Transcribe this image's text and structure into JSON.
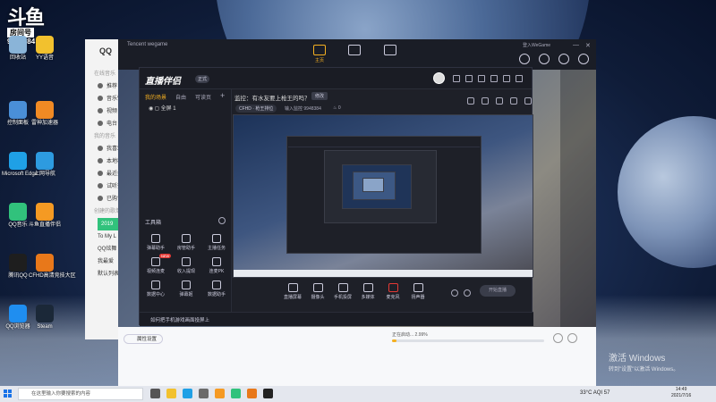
{
  "overlay": {
    "brand": "斗鱼",
    "room_label": "房间号",
    "room_number": "9948384"
  },
  "desktop_icons": [
    {
      "label": "回收站",
      "color": "#8ab4d8"
    },
    {
      "label": "YY语音",
      "color": "#f2c12e"
    },
    {
      "label": "控制面板",
      "color": "#4a8fd8"
    },
    {
      "label": "雷神加速器",
      "color": "#f08a24"
    },
    {
      "label": "Microsoft Edge",
      "color": "#1fa0e6"
    },
    {
      "label": "上网导航",
      "color": "#2d9be0"
    },
    {
      "label": "QQ音乐",
      "color": "#31c27c"
    },
    {
      "label": "斗鱼直播伴侣",
      "color": "#f59a23"
    },
    {
      "label": "腾讯QQ",
      "color": "#1e1e1e"
    },
    {
      "label": "CFHD高清竞技大区",
      "color": "#e8781a"
    },
    {
      "label": "QQ浏览器",
      "color": "#1f8ef0"
    },
    {
      "label": "Steam",
      "color": "#1b2838"
    }
  ],
  "qq_window": {
    "title": "QQ",
    "section1": "在线音乐",
    "items1": [
      "推荐",
      "音乐馆",
      "视频",
      "电台"
    ],
    "section2": "我的音乐",
    "items2": [
      "我喜欢",
      "本地和下载",
      "最近播放",
      "试听列表",
      "已购音乐"
    ],
    "section3": "创建的歌单",
    "year": "2019",
    "misc": [
      "To My L",
      "QQ炫舞",
      "我最爱",
      "默认列表"
    ]
  },
  "tencent_games": {
    "title": "Tencent wegame",
    "nav": {
      "home_label": "主页"
    },
    "wegame_label": "登入WeGame",
    "bottom": {
      "attribute_button": "属性设置",
      "status": "正在启动... 2.99%",
      "progress_percent": 2.99
    }
  },
  "streaming_app": {
    "logo": "直播伴侣",
    "version": "正式",
    "tabs": [
      "我的场景",
      "自由",
      "可读页"
    ],
    "scene": "全屏 1",
    "headline": "监控：有水友要上枪王的吗？",
    "edit_label": "修改",
    "category": "CFHD · 枪王排位",
    "room": "输入监控 9948384",
    "fans": "0",
    "toolbox_label": "工具箱",
    "tools": [
      {
        "label": "弹幕助手",
        "name": "danmu-helper"
      },
      {
        "label": "房管助手",
        "name": "room-admin"
      },
      {
        "label": "主播任务",
        "name": "streamer-task"
      },
      {
        "label": "视频连麦",
        "name": "video-link",
        "badge": "NEW"
      },
      {
        "label": "收入提现",
        "name": "income"
      },
      {
        "label": "连麦PK",
        "name": "link-pk"
      },
      {
        "label": "数据中心",
        "name": "data-center"
      },
      {
        "label": "弹幕姬",
        "name": "danmu-ji"
      },
      {
        "label": "数据助手",
        "name": "data-assistant"
      }
    ],
    "controls": [
      {
        "label": "直播屏幕",
        "name": "stream-screen"
      },
      {
        "label": "摄像头",
        "name": "camera"
      },
      {
        "label": "手机投屏",
        "name": "phone-cast"
      },
      {
        "label": "多媒体",
        "name": "multimedia"
      },
      {
        "label": "麦克风",
        "name": "microphone",
        "mic": true
      },
      {
        "label": "扬声器",
        "name": "speaker"
      }
    ],
    "go_live": "开始直播",
    "footer": "如何把手机游戏画面投屏上"
  },
  "watermark": {
    "line1": "激活 Windows",
    "line2": "转到\"设置\"以激活 Windows。"
  },
  "taskbar": {
    "search_placeholder": "在这里输入你要搜索的内容",
    "weather": "33°C AQI 57",
    "time": "14:49",
    "date": "2021/7/16",
    "icons": [
      {
        "name": "task-view",
        "color": "#555"
      },
      {
        "name": "explorer",
        "color": "#f2c12e"
      },
      {
        "name": "edge",
        "color": "#1fa0e6"
      },
      {
        "name": "store",
        "color": "#6b6b6b"
      },
      {
        "name": "douyu",
        "color": "#f59a23"
      },
      {
        "name": "qq-music",
        "color": "#31c27c"
      },
      {
        "name": "cfhd",
        "color": "#e8781a"
      },
      {
        "name": "wegame",
        "color": "#222"
      }
    ]
  }
}
